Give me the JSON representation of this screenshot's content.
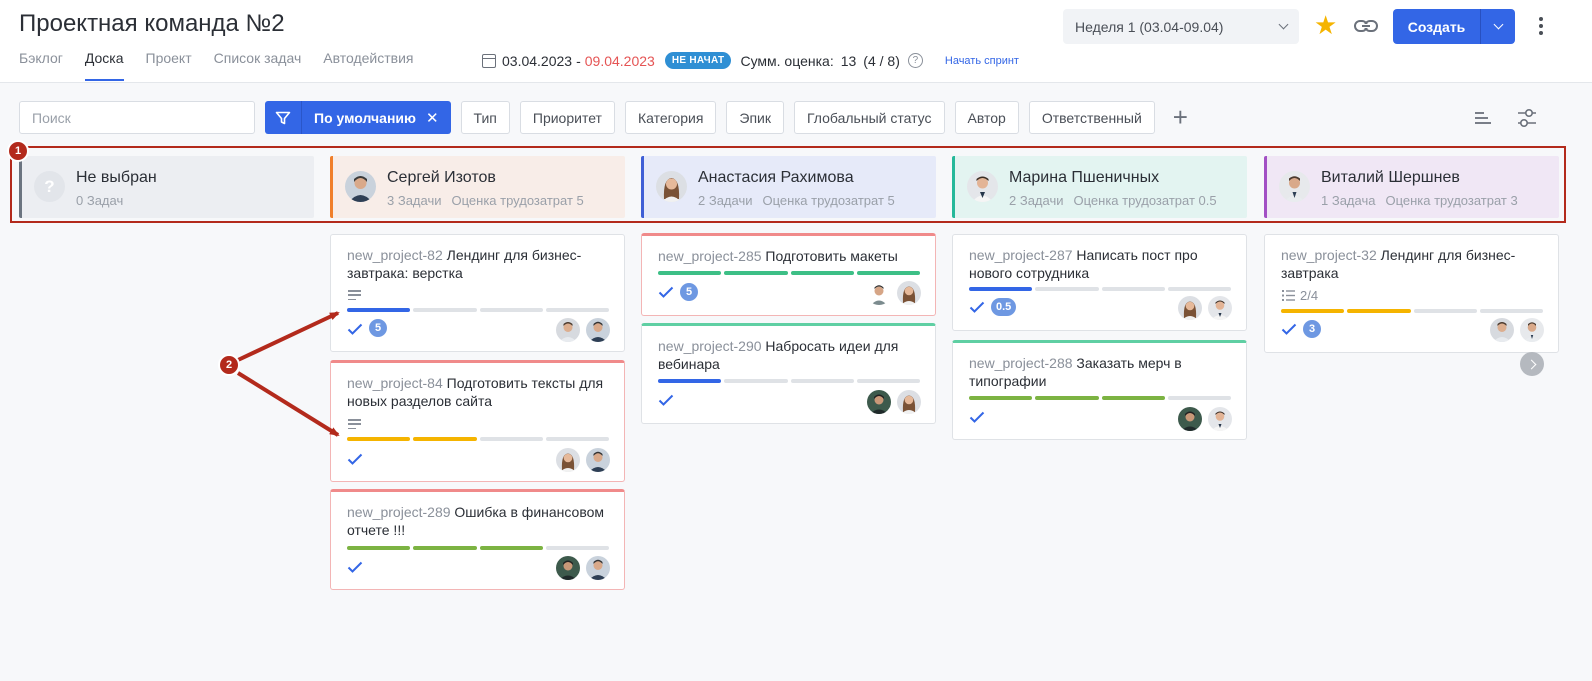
{
  "header": {
    "title": "Проектная команда №2",
    "tabs": [
      {
        "label": "Бэклог",
        "active": false
      },
      {
        "label": "Доска",
        "active": true
      },
      {
        "label": "Проект",
        "active": false
      },
      {
        "label": "Список задач",
        "active": false
      },
      {
        "label": "Автодействия",
        "active": false
      }
    ],
    "sprint": {
      "date_start": "03.04.2023",
      "date_sep": "-",
      "date_end": "09.04.2023",
      "status": "НЕ НАЧАТ",
      "estimate_label": "Сумм. оценка:",
      "estimate_value": "13",
      "estimate_ratio": "(4 / 8)",
      "start_link": "Начать спринт"
    },
    "week_select": "Неделя 1 (03.04-09.04)",
    "create_label": "Создать"
  },
  "filters": {
    "search_placeholder": "Поиск",
    "preset_label": "По умолчанию",
    "preset_close": "✕",
    "buttons": [
      "Тип",
      "Приоритет",
      "Категория",
      "Эпик",
      "Глобальный статус",
      "Автор",
      "Ответственный"
    ],
    "add_icon": "+"
  },
  "colors": {
    "accent": "#3366e6",
    "date_end": "#e55454",
    "annotation": "#b32a1c",
    "progress_blue": "#3366e6",
    "progress_green": "#3dbf86",
    "progress_yellow": "#f5b400",
    "progress_olive": "#7cb342",
    "progress_empty": "#dfe2e6"
  },
  "lanes": [
    {
      "name": "Не выбран",
      "tasks": "0 Задач",
      "estimate": ""
    },
    {
      "name": "Сергей Изотов",
      "tasks": "3 Задачи",
      "estimate": "Оценка трудозатрат 5"
    },
    {
      "name": "Анастасия Рахимова",
      "tasks": "2 Задачи",
      "estimate": "Оценка трудозатрат 5"
    },
    {
      "name": "Марина Пшеничных",
      "tasks": "2 Задачи",
      "estimate": "Оценка трудозатрат 0.5"
    },
    {
      "name": "Виталий Шершнев",
      "tasks": "1 Задача",
      "estimate": "Оценка трудозатрат 3"
    }
  ],
  "cards": [
    {
      "key": "new_project-82",
      "title": "Лендинг для бизнес-завтрака: верстка",
      "estimate": "5"
    },
    {
      "key": "new_project-84",
      "title": "Подготовить тексты для новых разделов сайта",
      "estimate": ""
    },
    {
      "key": "new_project-289",
      "title": "Ошибка в финансовом отчете !!!",
      "estimate": ""
    },
    {
      "key": "new_project-285",
      "title": "Подготовить макеты",
      "estimate": "5"
    },
    {
      "key": "new_project-290",
      "title": "Набросать идеи для вебинара",
      "estimate": ""
    },
    {
      "key": "new_project-287",
      "title": "Написать пост про нового сотрудника",
      "estimate": "0.5"
    },
    {
      "key": "new_project-288",
      "title": "Заказать мерч в типографии",
      "estimate": ""
    },
    {
      "key": "new_project-32",
      "title": "Лендинг для бизнес-завтрака",
      "estimate": "3",
      "subtasks": "2/4"
    }
  ],
  "annotations": {
    "marker_1": "1",
    "marker_2": "2"
  }
}
